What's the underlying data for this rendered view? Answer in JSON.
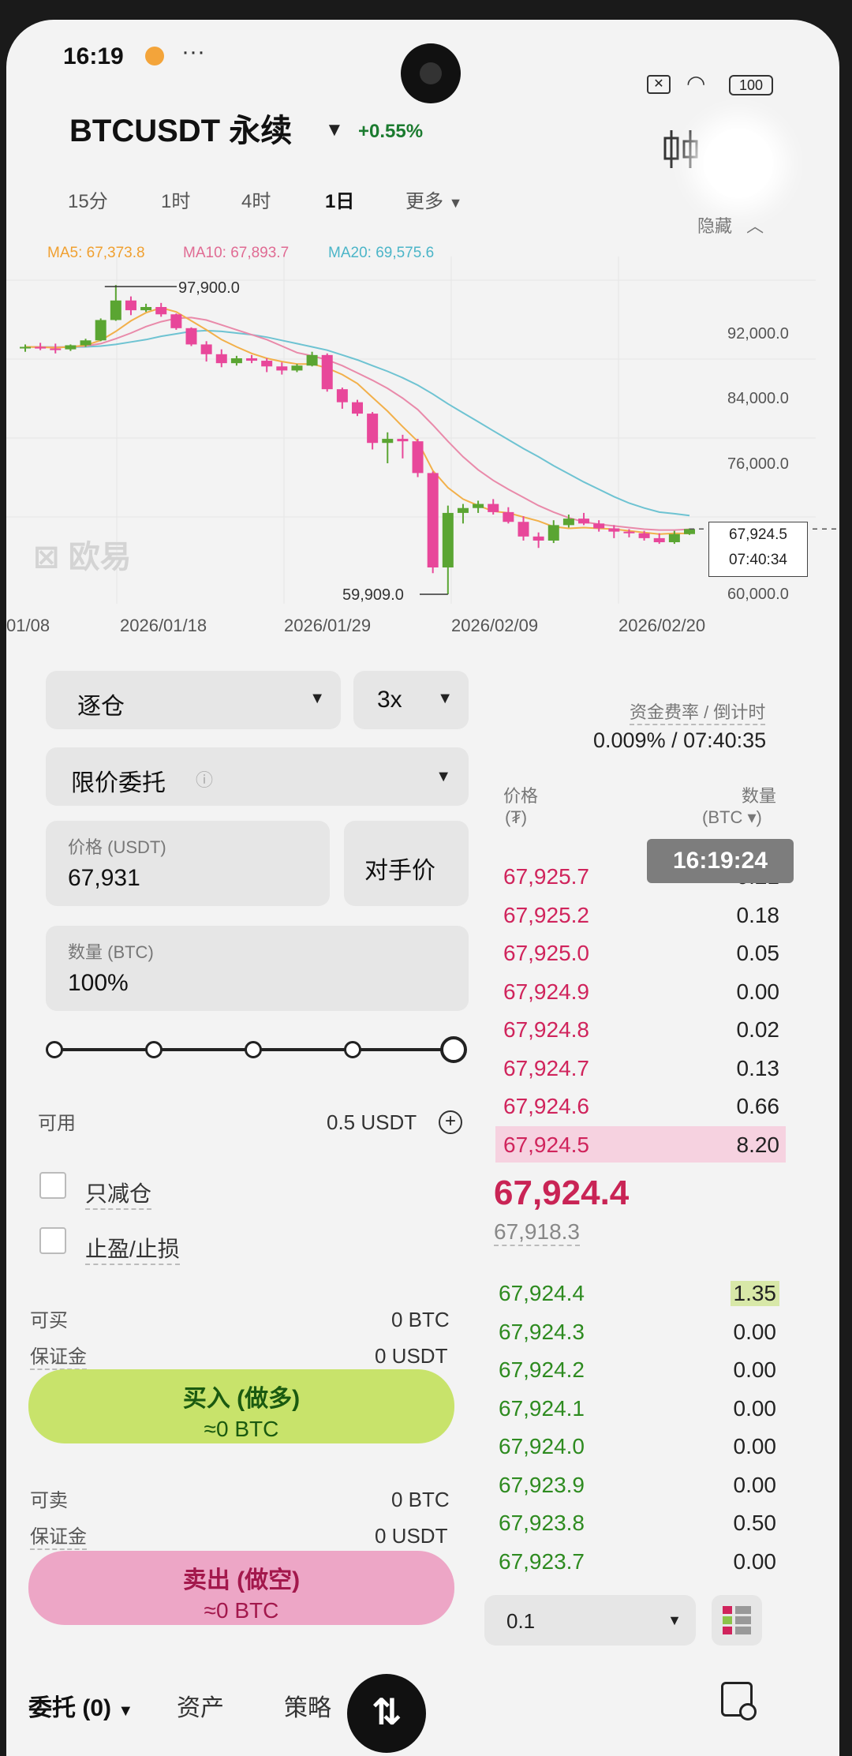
{
  "status_bar": {
    "time": "16:19",
    "battery": "100"
  },
  "header": {
    "symbol": "BTCUSDT 永续",
    "change": "+0.55%"
  },
  "timeframes": [
    "15分",
    "1时",
    "4时",
    "1日"
  ],
  "more_label": "更多",
  "hide_label": "隐藏",
  "ma": {
    "ma5": "MA5: 67,373.8",
    "ma10": "MA10: 67,893.7",
    "ma20": "MA20: 69,575.6"
  },
  "chart_data": {
    "type": "candlestick",
    "x_tick_labels": [
      "01/08",
      "2026/01/18",
      "2026/01/29",
      "2026/02/09",
      "2026/02/20"
    ],
    "y_tick_labels": [
      "92,000.0",
      "84,000.0",
      "76,000.0",
      "60,000.0"
    ],
    "annotations": {
      "high": "97,900.0",
      "low": "59,909.0"
    },
    "current_price": "67,924.5",
    "countdown": "07:40:34",
    "watermark": "欧易",
    "candles": [
      [
        90200,
        90600,
        89700,
        90300
      ],
      [
        90300,
        90800,
        89900,
        90100
      ],
      [
        90100,
        90700,
        89500,
        90000
      ],
      [
        90000,
        90600,
        89800,
        90500
      ],
      [
        90500,
        91300,
        90300,
        91100
      ],
      [
        91100,
        93800,
        91000,
        93600
      ],
      [
        93600,
        97900,
        93500,
        96000
      ],
      [
        96000,
        96500,
        94200,
        94800
      ],
      [
        94800,
        95600,
        94600,
        95200
      ],
      [
        95200,
        95700,
        94000,
        94300
      ],
      [
        94300,
        94400,
        92400,
        92600
      ],
      [
        92600,
        92700,
        90400,
        90600
      ],
      [
        90600,
        91000,
        88500,
        89400
      ],
      [
        89400,
        90000,
        87800,
        88300
      ],
      [
        88300,
        89200,
        88000,
        88900
      ],
      [
        88900,
        89300,
        88300,
        88600
      ],
      [
        88600,
        88900,
        87200,
        87900
      ],
      [
        87900,
        88400,
        86900,
        87400
      ],
      [
        87400,
        88200,
        87200,
        88000
      ],
      [
        88000,
        89700,
        87900,
        89300
      ],
      [
        89300,
        89500,
        84800,
        85100
      ],
      [
        85100,
        85300,
        82700,
        83500
      ],
      [
        83500,
        83800,
        81800,
        82100
      ],
      [
        82100,
        82300,
        77700,
        78500
      ],
      [
        78500,
        79800,
        76000,
        79000
      ],
      [
        79000,
        79500,
        76600,
        78700
      ],
      [
        78700,
        79000,
        74300,
        74800
      ],
      [
        74800,
        75000,
        62500,
        63200
      ],
      [
        63200,
        70800,
        59909,
        69900
      ],
      [
        69900,
        71000,
        68600,
        70500
      ],
      [
        70500,
        71400,
        69900,
        71000
      ],
      [
        71000,
        71600,
        69700,
        70000
      ],
      [
        70000,
        70600,
        68600,
        68800
      ],
      [
        68800,
        69500,
        66500,
        67000
      ],
      [
        67000,
        67500,
        65600,
        66500
      ],
      [
        66500,
        69000,
        66200,
        68400
      ],
      [
        68400,
        69700,
        68100,
        69200
      ],
      [
        69200,
        69900,
        68400,
        68600
      ],
      [
        68600,
        69000,
        67600,
        68000
      ],
      [
        68000,
        68400,
        66800,
        67600
      ],
      [
        67600,
        67900,
        66900,
        67400
      ],
      [
        67400,
        67700,
        66500,
        66800
      ],
      [
        66800,
        67400,
        66100,
        66300
      ],
      [
        66300,
        67700,
        66100,
        67300
      ],
      [
        67300,
        68000,
        67200,
        67924.5
      ]
    ],
    "ma5": [
      90300,
      90260,
      90200,
      90300,
      90500,
      91100,
      92200,
      93500,
      94500,
      95100,
      94600,
      93500,
      92400,
      91200,
      90300,
      89500,
      88900,
      88500,
      88200,
      88200,
      87700,
      86900,
      85800,
      84100,
      82400,
      80500,
      78700,
      75100,
      73000,
      71600,
      70800,
      70100,
      69900,
      69400,
      68900,
      68200,
      68000,
      68100,
      68000,
      67900,
      67700,
      67500,
      67300,
      67400,
      67374
    ],
    "ma10": [
      90300,
      90280,
      90250,
      90300,
      90400,
      90700,
      91300,
      92000,
      92800,
      93400,
      93800,
      93900,
      93600,
      93000,
      92400,
      91800,
      91200,
      90400,
      89600,
      89200,
      88700,
      88000,
      87100,
      86200,
      85200,
      84000,
      82600,
      80700,
      78700,
      76800,
      75200,
      73900,
      72800,
      71800,
      70800,
      70000,
      69300,
      68800,
      68500,
      68300,
      68100,
      67900,
      67800,
      67800,
      67894
    ],
    "ma20": [
      90300,
      90290,
      90280,
      90280,
      90300,
      90400,
      90600,
      90900,
      91200,
      91600,
      91900,
      92200,
      92300,
      92200,
      92000,
      91800,
      91500,
      91100,
      90700,
      90300,
      89900,
      89300,
      88700,
      88000,
      87300,
      86500,
      85600,
      84500,
      83300,
      82200,
      81100,
      80000,
      78900,
      77800,
      76800,
      75700,
      74700,
      73700,
      72800,
      71900,
      71100,
      70500,
      70000,
      69800,
      69576
    ]
  },
  "order": {
    "margin_mode": "逐仓",
    "leverage": "3x",
    "order_type": "限价委托",
    "price_label": "价格 (USDT)",
    "price_value": "67,931",
    "counter_price": "对手价",
    "qty_label": "数量 (BTC)",
    "qty_value": "100%",
    "available_label": "可用",
    "available_value": "0.5 USDT",
    "reduce_only": "只减仓",
    "tp_sl": "止盈/止损",
    "can_buy_label": "可买",
    "can_buy_value": "0 BTC",
    "margin_label": "保证金",
    "margin_buy_value": "0 USDT",
    "buy_label": "买入 (做多)",
    "buy_sub": "≈0 BTC",
    "can_sell_label": "可卖",
    "can_sell_value": "0 BTC",
    "margin_sell_value": "0 USDT",
    "sell_label": "卖出 (做空)",
    "sell_sub": "≈0 BTC"
  },
  "funding": {
    "label": "资金费率 / 倒计时",
    "value": "0.009% / 07:40:35"
  },
  "orderbook": {
    "price_header": "价格",
    "price_unit": "(₮)",
    "qty_header": "数量",
    "qty_unit": "(BTC ▾)",
    "time_toast": "16:19:24",
    "asks": [
      {
        "price": "67,925.7",
        "qty": "0.21"
      },
      {
        "price": "67,925.2",
        "qty": "0.18"
      },
      {
        "price": "67,925.0",
        "qty": "0.05"
      },
      {
        "price": "67,924.9",
        "qty": "0.00"
      },
      {
        "price": "67,924.8",
        "qty": "0.02"
      },
      {
        "price": "67,924.7",
        "qty": "0.13"
      },
      {
        "price": "67,924.6",
        "qty": "0.66"
      },
      {
        "price": "67,924.5",
        "qty": "8.20"
      }
    ],
    "last_price": "67,924.4",
    "mark_price": "67,918.3",
    "bids": [
      {
        "price": "67,924.4",
        "qty": "1.35"
      },
      {
        "price": "67,924.3",
        "qty": "0.00"
      },
      {
        "price": "67,924.2",
        "qty": "0.00"
      },
      {
        "price": "67,924.1",
        "qty": "0.00"
      },
      {
        "price": "67,924.0",
        "qty": "0.00"
      },
      {
        "price": "67,923.9",
        "qty": "0.00"
      },
      {
        "price": "67,923.8",
        "qty": "0.50"
      },
      {
        "price": "67,923.7",
        "qty": "0.00"
      }
    ],
    "precision": "0.1"
  },
  "bottom_tabs": {
    "orders": "委托 (0)",
    "assets": "资产",
    "strategy": "策略"
  }
}
